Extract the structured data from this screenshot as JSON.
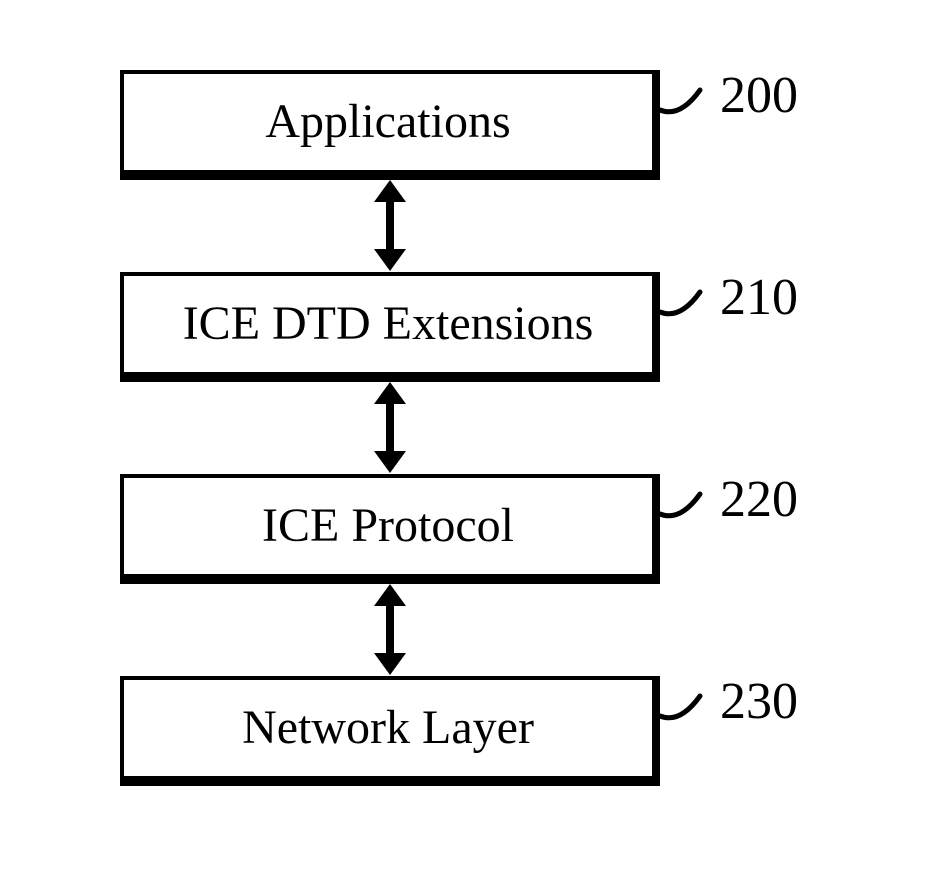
{
  "diagram": {
    "boxes": [
      {
        "id": "applications",
        "label": "Applications",
        "ref": "200"
      },
      {
        "id": "ice-dtd-extensions",
        "label": "ICE DTD Extensions",
        "ref": "210"
      },
      {
        "id": "ice-protocol",
        "label": "ICE Protocol",
        "ref": "220"
      },
      {
        "id": "network-layer",
        "label": "Network Layer",
        "ref": "230"
      }
    ]
  }
}
